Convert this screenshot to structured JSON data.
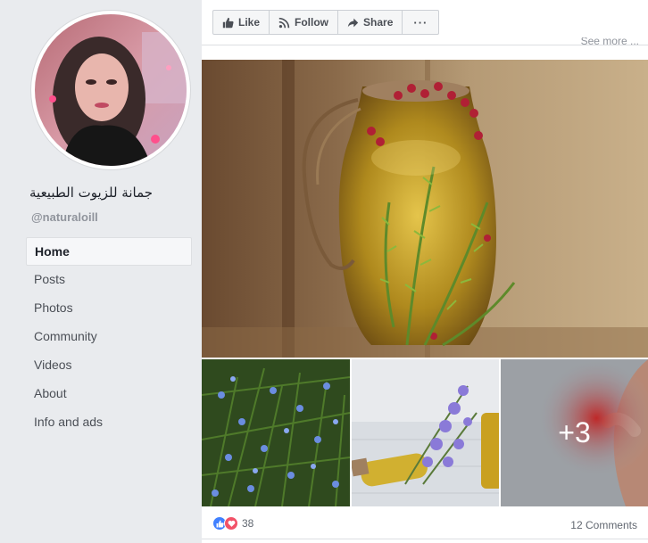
{
  "sidebar": {
    "page_name": "جمانة للزيوت الطبيعية",
    "handle": "@naturaloill",
    "items": [
      {
        "label": "Home",
        "active": true
      },
      {
        "label": "Posts"
      },
      {
        "label": "Photos"
      },
      {
        "label": "Community"
      },
      {
        "label": "Videos"
      },
      {
        "label": "About"
      },
      {
        "label": "Info and ads"
      }
    ]
  },
  "toolbar": {
    "like_label": "Like",
    "follow_label": "Follow",
    "share_label": "Share",
    "more_label": "···"
  },
  "post": {
    "see_more": "See more ...",
    "extra_photos": "+3",
    "reaction_count": "38",
    "comments": "12 Comments"
  },
  "colors": {
    "like_blue": "#4080ff",
    "love_red": "#f25268",
    "text_dark": "#1d2129",
    "text_muted": "#90949c"
  }
}
